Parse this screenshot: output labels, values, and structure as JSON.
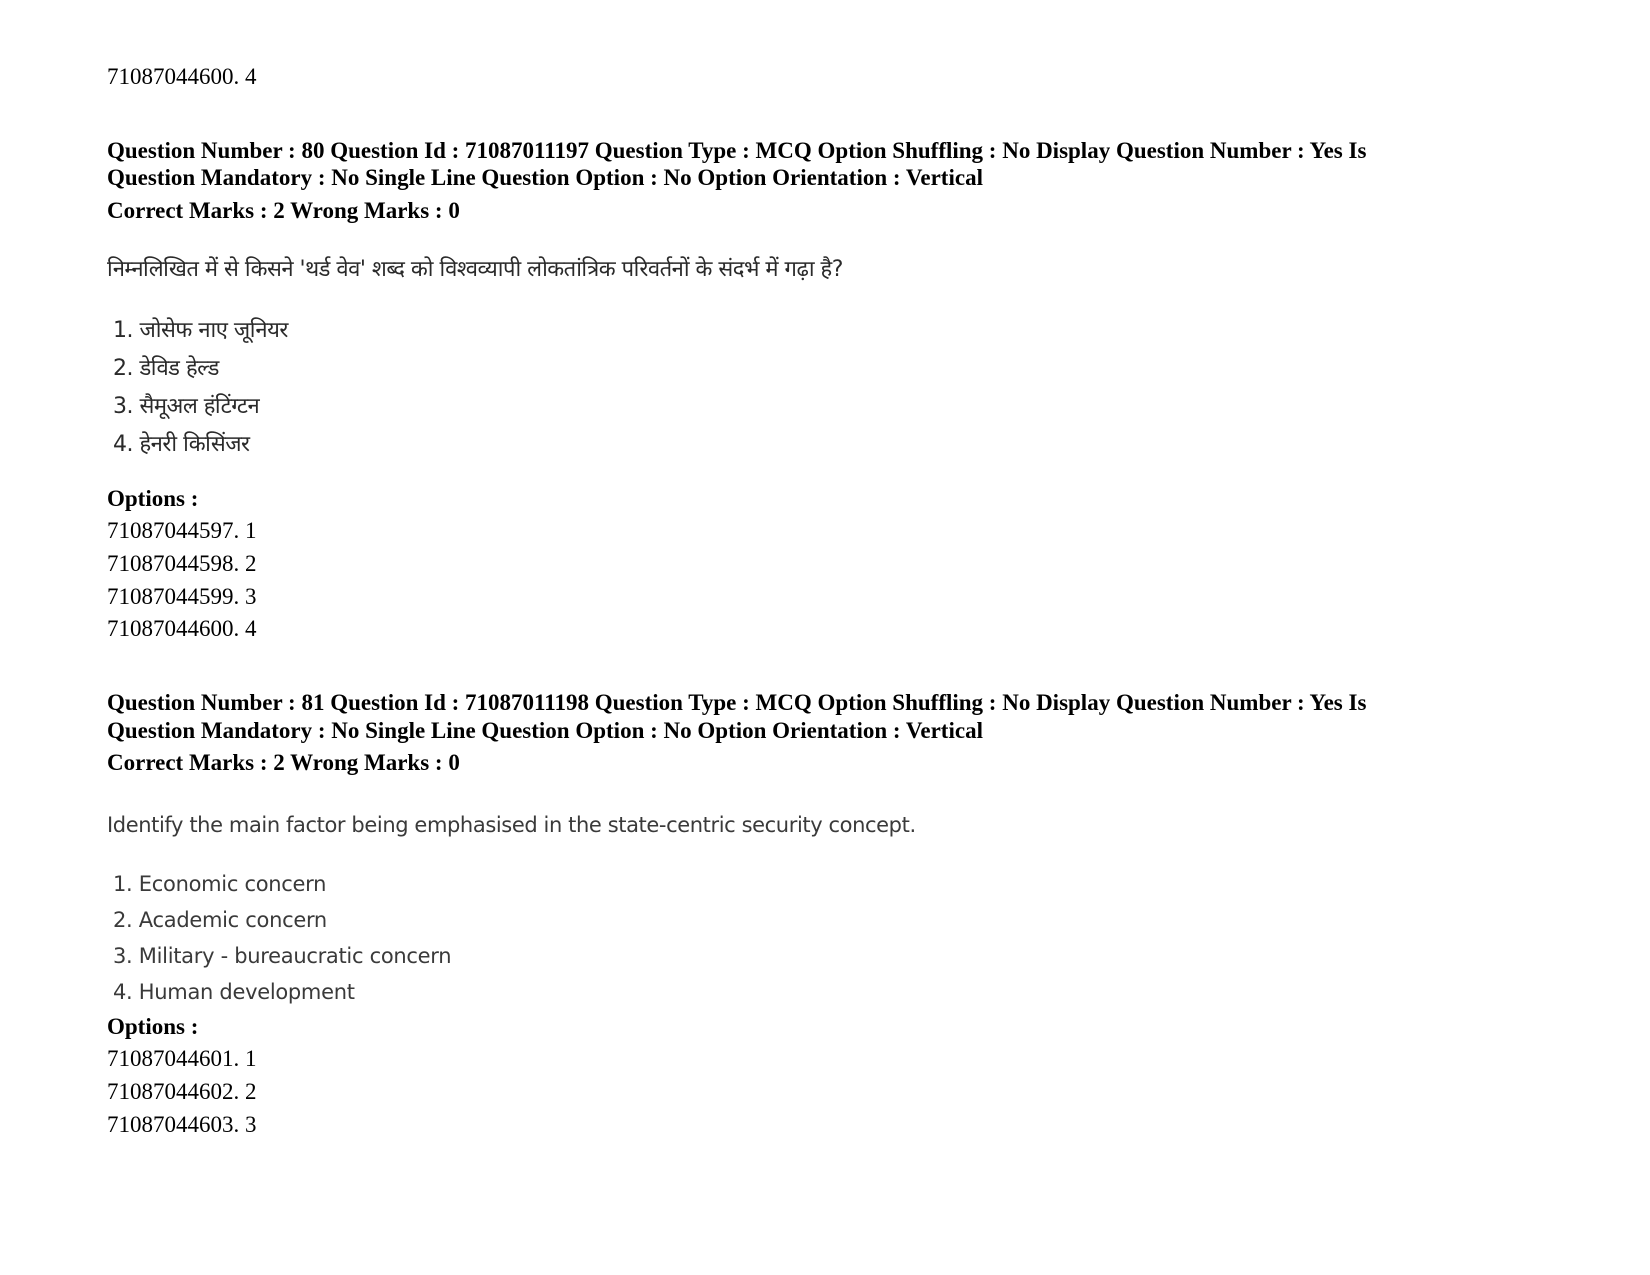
{
  "top_option": "71087044600. 4",
  "q80": {
    "meta_line1": "Question Number : 80 Question Id : 71087011197 Question Type : MCQ Option Shuffling : No Display Question Number : Yes Is",
    "meta_line2": "Question Mandatory : No Single Line Question Option : No Option Orientation : Vertical",
    "marks": "Correct Marks : 2 Wrong Marks : 0",
    "question": "निम्नलिखित में से किसने 'थर्ड वेव' शब्द को विश्वव्यापी लोकतांत्रिक परिवर्तनों के संदर्भ में गढ़ा है?",
    "choices": [
      "1. जोसेफ नाए जूनियर",
      "2. डेविड हेल्ड",
      "3. सैमूअल हंटिंग्टन",
      "4. हेनरी किसिंजर"
    ],
    "options_label": "Options :",
    "options": [
      "71087044597. 1",
      "71087044598. 2",
      "71087044599. 3",
      "71087044600. 4"
    ]
  },
  "q81": {
    "meta_line1": "Question Number : 81 Question Id : 71087011198 Question Type : MCQ Option Shuffling : No Display Question Number : Yes Is",
    "meta_line2": "Question Mandatory : No Single Line Question Option : No Option Orientation : Vertical",
    "marks": "Correct Marks : 2 Wrong Marks : 0",
    "question": "Identify the main factor being emphasised in the state-centric  security concept.",
    "choices": [
      "1. Economic concern",
      "2. Academic concern",
      "3. Military - bureaucratic concern",
      "4. Human development"
    ],
    "options_label": "Options :",
    "options": [
      "71087044601. 1",
      "71087044602. 2",
      "71087044603. 3"
    ]
  }
}
